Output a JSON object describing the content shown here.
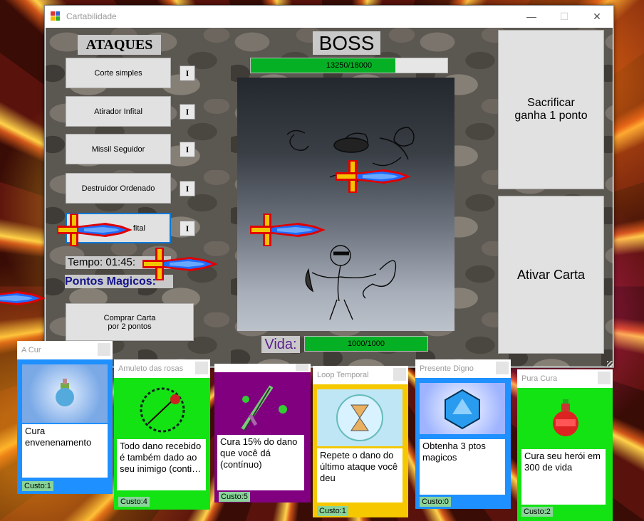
{
  "window": {
    "title": "Cartabilidade",
    "minimize": "—",
    "maximize": "☐",
    "close": "✕"
  },
  "attacks": {
    "heading": "ATAQUES",
    "items": [
      {
        "label": "Corte simples",
        "level": "I"
      },
      {
        "label": "Atirador Infital",
        "level": "I"
      },
      {
        "label": "Missil Seguidor",
        "level": "I"
      },
      {
        "label": "Destruidor Ordenado",
        "level": "I"
      },
      {
        "label": "fital",
        "level": "I"
      }
    ]
  },
  "status": {
    "time": "Tempo: 01:45:",
    "magic_points": "Pontos Magicos:"
  },
  "buy_card": {
    "line1": "Comprar Carta",
    "line2": "por 2 pontos"
  },
  "boss": {
    "title": "BOSS",
    "hp_text": "13250/18000",
    "hp_fraction": 0.736
  },
  "player": {
    "label": "Vida:",
    "hp_text": "1000/1000",
    "hp_fraction": 1.0
  },
  "actions": {
    "sacrifice_line1": "Sacrificar",
    "sacrifice_line2": "ganha 1 ponto",
    "activate": "Ativar Carta"
  },
  "cards": [
    {
      "title": "A Cur",
      "desc": "Cura envenenamento",
      "cost": "Custo:1",
      "bg": "#1e90ff"
    },
    {
      "title": "Amuleto das rosas",
      "desc": "Todo dano recebido é também dado ao seu inimigo (conti…",
      "cost": "Custo:4",
      "bg": "#13e313"
    },
    {
      "title": "",
      "desc": "Cura 15% do dano que você dá (contínuo)",
      "cost": "Custo:5",
      "bg": "#800080"
    },
    {
      "title": "Loop Temporal",
      "desc": "Repete o dano do último ataque você deu",
      "cost": "Custo:1",
      "bg": "#f5c800"
    },
    {
      "title": "Presente Digno",
      "desc": "Obtenha 3 ptos magicos",
      "cost": "Custo:0",
      "bg": "#1e90ff"
    },
    {
      "title": "Pura Cura",
      "desc": "Cura seu herói em 300 de vida",
      "cost": "Custo:2",
      "bg": "#13e313"
    }
  ]
}
